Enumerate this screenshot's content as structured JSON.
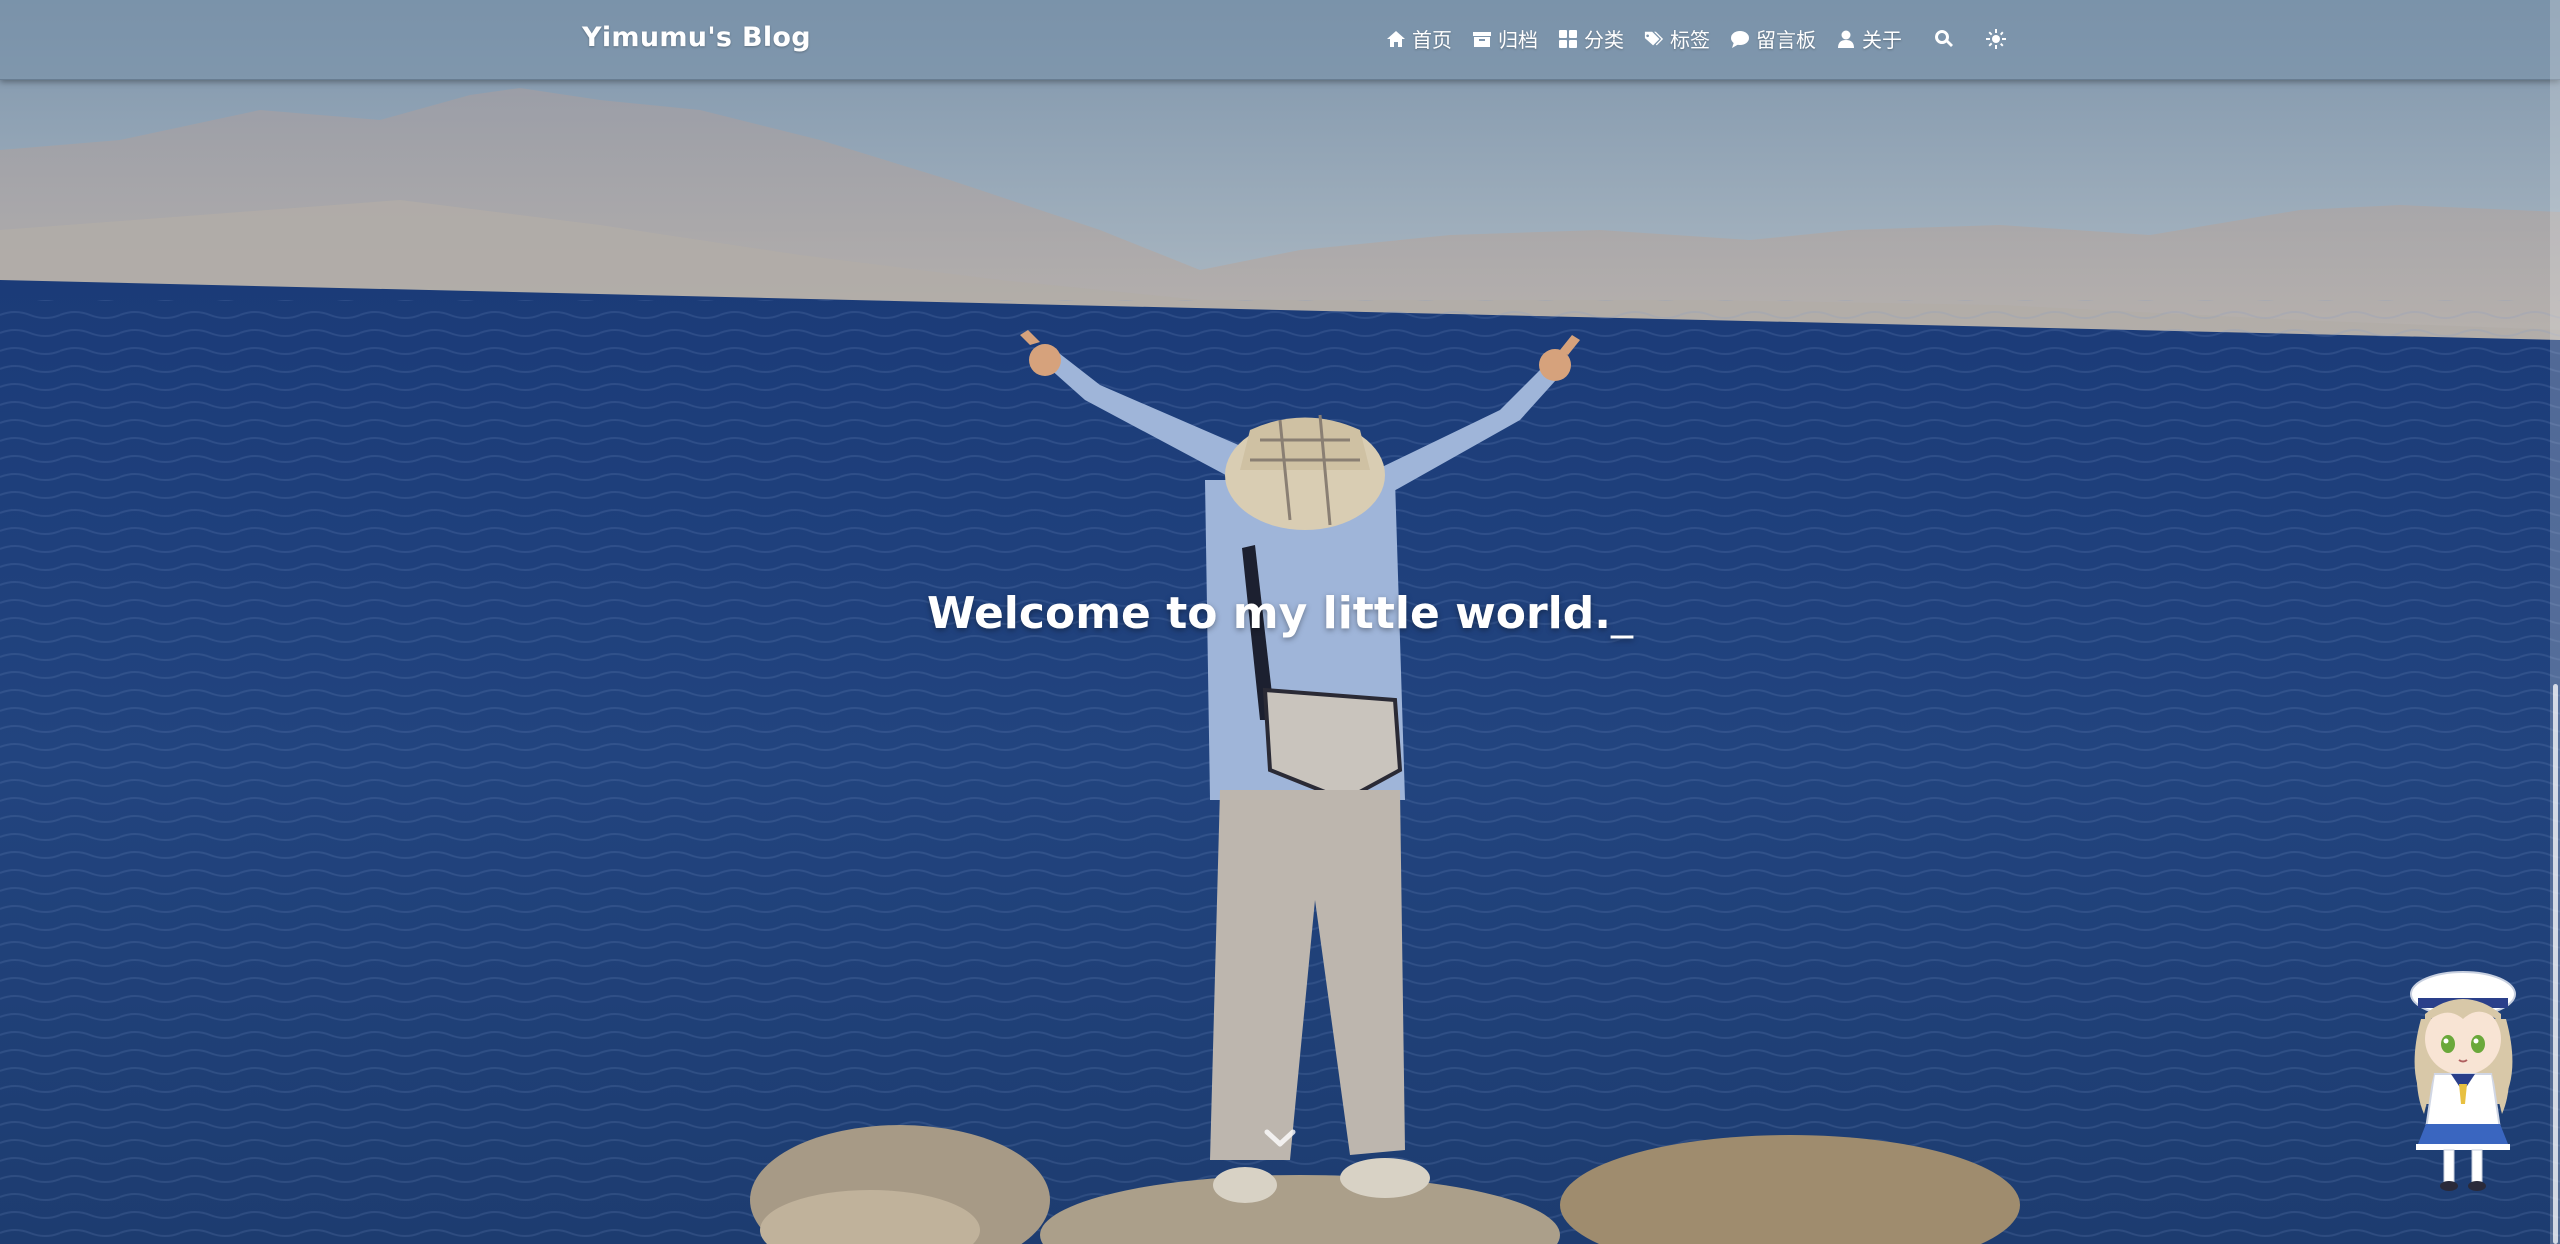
{
  "brand": "Yimumu's Blog",
  "nav": {
    "items": [
      {
        "icon": "home-icon",
        "label": "首页"
      },
      {
        "icon": "archive-icon",
        "label": "归档"
      },
      {
        "icon": "category-icon",
        "label": "分类"
      },
      {
        "icon": "tags-icon",
        "label": "标签"
      },
      {
        "icon": "comment-icon",
        "label": "留言板"
      },
      {
        "icon": "user-icon",
        "label": "关于"
      }
    ],
    "search_icon": "search-icon",
    "theme_icon": "sun-icon"
  },
  "hero": {
    "welcome": "Welcome to my little world.",
    "cursor": "_",
    "scroll_icon": "chevron-down-icon"
  },
  "mascot": {
    "icon": "live2d-mascot"
  },
  "colors": {
    "nav_bg": "#7891aa",
    "sea": "#1e3f78",
    "sky": "#9fb0c0",
    "text": "#ffffff"
  }
}
